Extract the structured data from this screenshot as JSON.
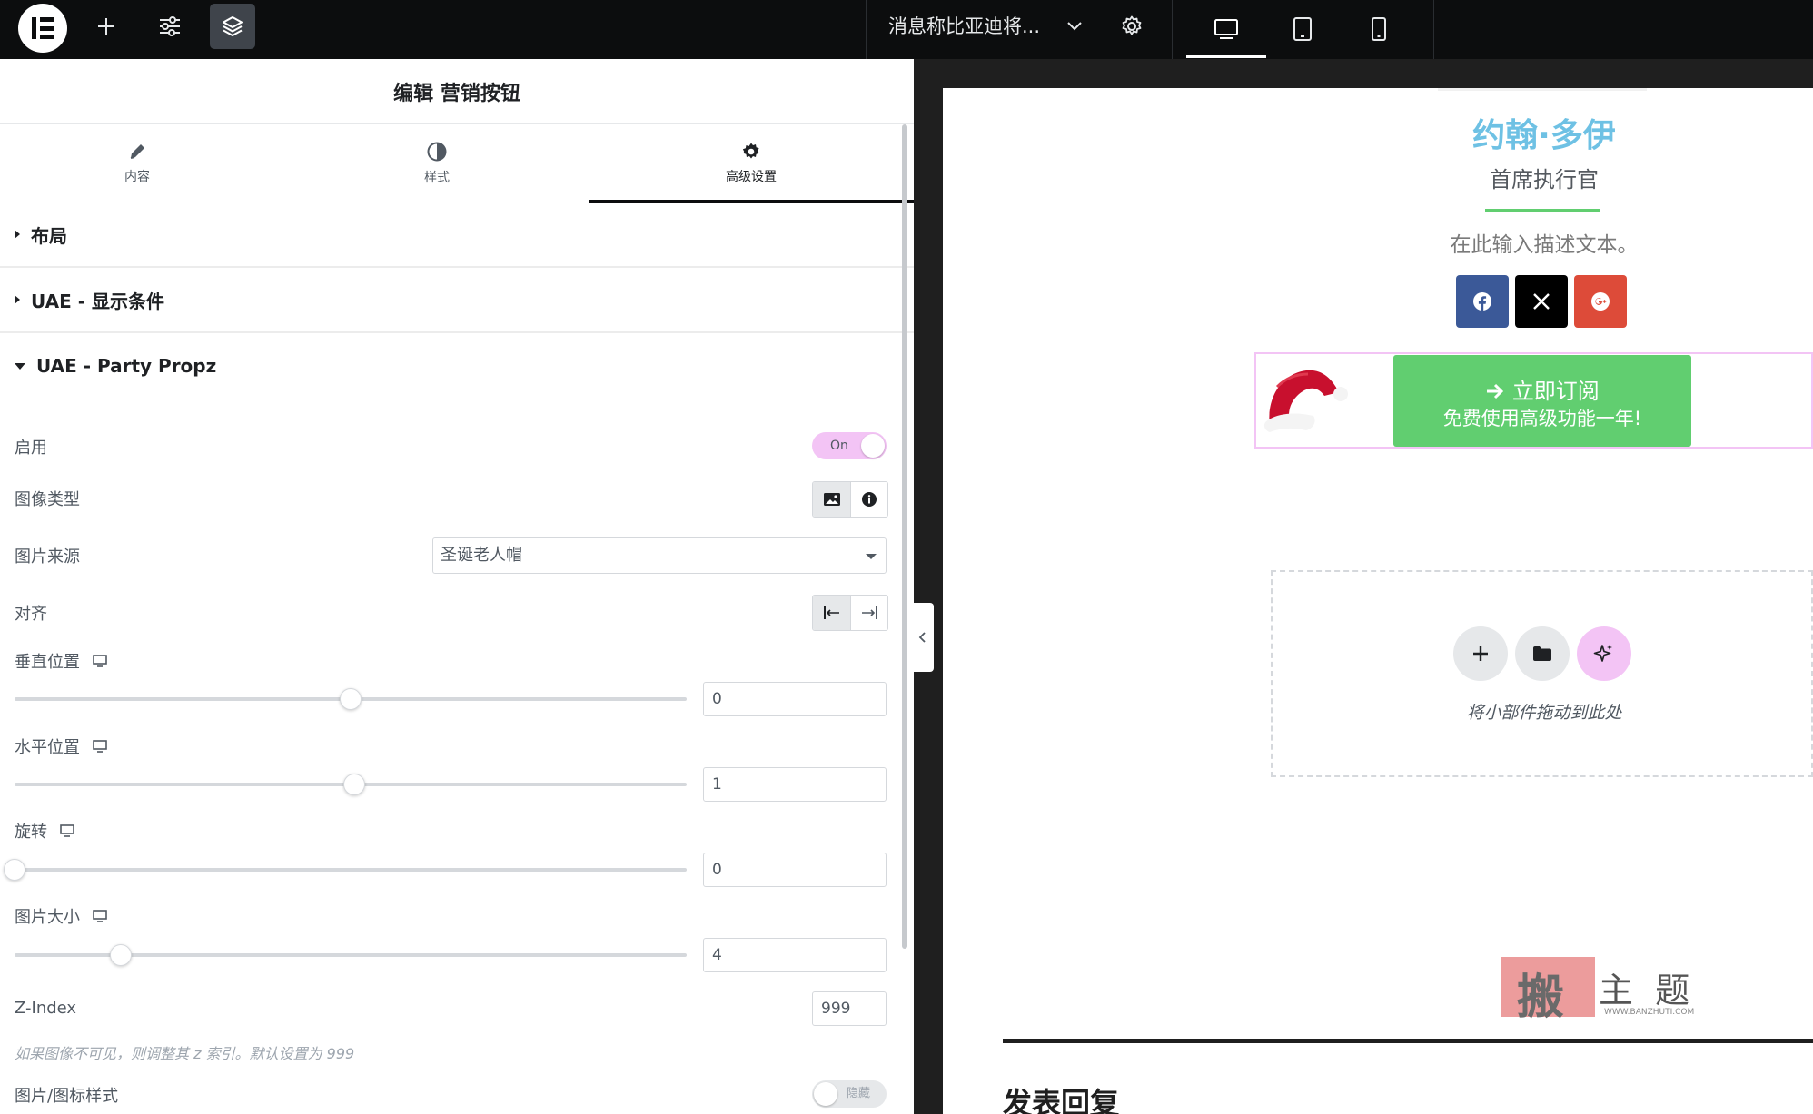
{
  "topbar": {
    "document_title": "消息称比亚迪将...",
    "colors": {
      "bar": "#0c0d0e",
      "active_button": "#3f444b"
    }
  },
  "panel": {
    "title": "编辑 营销按钮",
    "tabs": [
      {
        "label": "内容",
        "icon": "pencil-icon"
      },
      {
        "label": "样式",
        "icon": "half-circle-icon"
      },
      {
        "label": "高级设置",
        "icon": "gear-icon",
        "active": true
      }
    ],
    "sections": [
      {
        "label": "布局",
        "expanded": false
      },
      {
        "label": "UAE - 显示条件",
        "expanded": false
      },
      {
        "label": "UAE - Party Propz",
        "expanded": true
      }
    ],
    "fields": {
      "enable": {
        "label": "启用",
        "state": "On"
      },
      "image_type": {
        "label": "图像类型",
        "options": [
          "image-icon",
          "info-icon"
        ],
        "selected": 0
      },
      "image_source": {
        "label": "图片来源",
        "value": "圣诞老人帽"
      },
      "align": {
        "label": "对齐",
        "options": [
          "align-left-icon",
          "align-right-icon"
        ],
        "selected": 0
      },
      "vertical": {
        "label": "垂直位置",
        "value": "0",
        "slider_fraction": 0.5
      },
      "horizontal": {
        "label": "水平位置",
        "value": "1",
        "slider_fraction": 0.505
      },
      "rotate": {
        "label": "旋转",
        "value": "0",
        "slider_fraction": 0.0
      },
      "size": {
        "label": "图片大小",
        "value": "4",
        "slider_fraction": 0.158
      },
      "z_index": {
        "label": "Z-Index",
        "value": "999",
        "help": "如果图像不可见，则调整其 z 索引。默认设置为 999"
      },
      "icon_style": {
        "label": "图片/图标样式",
        "state": "隐藏"
      }
    },
    "colors": {
      "accent": "#f3c4f5",
      "text": "#515962"
    }
  },
  "preview": {
    "name": "约翰·多伊",
    "role": "首席执行官",
    "description": "在此输入描述文本。",
    "social": [
      {
        "icon": "facebook-icon",
        "color": "#3b5998"
      },
      {
        "icon": "x-icon",
        "color": "#000000"
      },
      {
        "icon": "google-plus-icon",
        "color": "#dd4b39"
      }
    ],
    "cta": {
      "line1": "立即订阅",
      "line2": "免费使用高级功能一年!",
      "color": "#61ce70",
      "icon": "arrow-right-icon"
    },
    "decoration": "santa-hat-icon",
    "dropzone_text": "将小部件拖动到此处",
    "watermark": {
      "text": "主 题",
      "url": "WWW.BANZHUTI.COM",
      "stamp": "搬"
    },
    "reply_heading": "发表回复",
    "colors": {
      "name": "#6ec1e4",
      "divider": "#61ce70"
    }
  }
}
